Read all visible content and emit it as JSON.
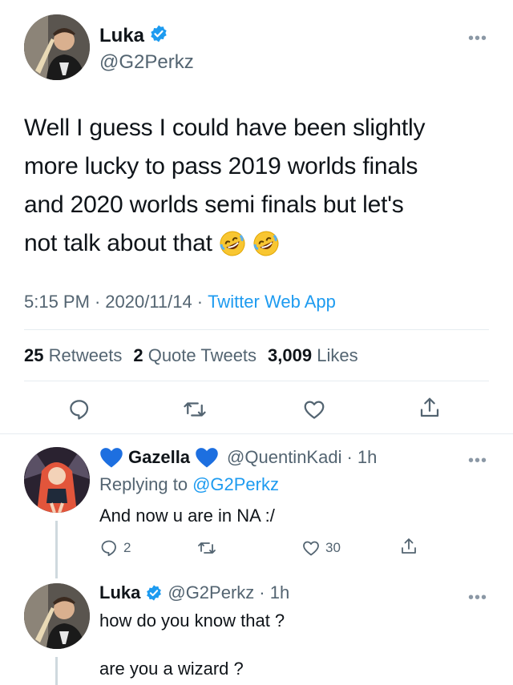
{
  "main_tweet": {
    "author_name": "Luka",
    "author_handle": "@G2Perkz",
    "verified": true,
    "text_lines": [
      "Well I guess I could have been slightly",
      "more lucky to pass 2019 worlds finals",
      "and 2020 worlds semi finals but let's",
      "not talk about that"
    ],
    "emoji": [
      "rolling-on-floor-laughing",
      "rolling-on-floor-laughing"
    ],
    "time": "5:15 PM",
    "date": "2020/11/14",
    "separator": "·",
    "source": "Twitter Web App",
    "stats": {
      "retweets_count": "25",
      "retweets_label": "Retweets",
      "quotes_count": "2",
      "quotes_label": "Quote Tweets",
      "likes_count": "3,009",
      "likes_label": "Likes"
    }
  },
  "replies": [
    {
      "author_name": "Gazella",
      "author_handle": "@QuentinKadi",
      "age": "· 1h",
      "replying_prefix": "Replying to",
      "replying_to": "@G2Perkz",
      "text": "And now u are in NA :/",
      "reply_count": "2",
      "like_count": "30"
    },
    {
      "author_name": "Luka",
      "author_handle": "@G2Perkz",
      "age": "· 1h",
      "text_line1": "how do you know that ?",
      "text_line2": "are you a wizard ?"
    }
  ],
  "colors": {
    "accent": "#1d9bf0",
    "secondary_text": "#536471",
    "divider": "#e6ecf0",
    "heart_blue": "#1d6fe0"
  }
}
